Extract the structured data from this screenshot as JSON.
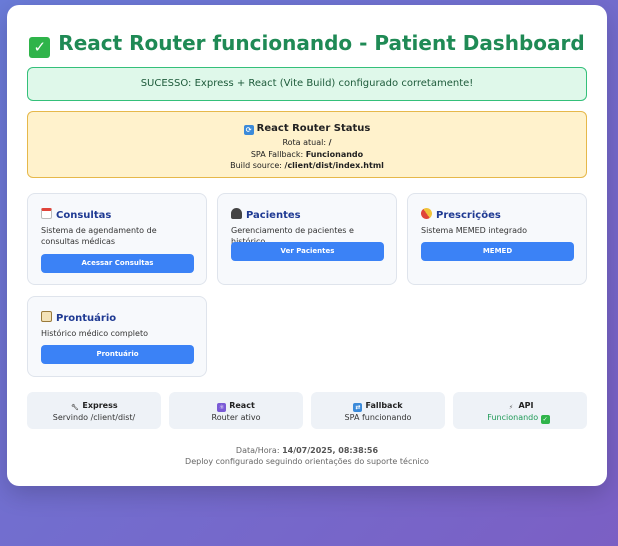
{
  "header": {
    "title": "React Router funcionando - Patient Dashboard",
    "title_icon": "check-mark-icon"
  },
  "success": {
    "text": "SUCESSO: Express + React (Vite Build) configurado corretamente!"
  },
  "router_status": {
    "title": "React Router Status",
    "icon": "sync-icon",
    "route_label": "Rota atual:",
    "route_value": "/",
    "fallback_label": "SPA Fallback:",
    "fallback_value": "Funcionando",
    "build_label": "Build source:",
    "build_value": "/client/dist/index.html"
  },
  "modules": [
    {
      "title": "Consultas",
      "icon": "calendar-icon",
      "description": "Sistema de agendamento de consultas médicas",
      "button": "Acessar Consultas"
    },
    {
      "title": "Pacientes",
      "icon": "people-icon",
      "description": "Gerenciamento de pacientes e histórico",
      "button": "Ver Pacientes"
    },
    {
      "title": "Prescrições",
      "icon": "pill-icon",
      "description": "Sistema MEMED integrado",
      "button": "MEMED"
    },
    {
      "title": "Prontuário",
      "icon": "clipboard-icon",
      "description": "Histórico médico completo",
      "button": "Prontuário"
    }
  ],
  "info_cards": [
    {
      "title": "Express",
      "icon": "wrench-icon",
      "subtitle": "Servindo /client/dist/"
    },
    {
      "title": "React",
      "icon": "react-icon",
      "subtitle": "Router ativo"
    },
    {
      "title": "Fallback",
      "icon": "shuffle-icon",
      "subtitle": "SPA funcionando"
    },
    {
      "title": "API",
      "icon": "plug-icon",
      "subtitle": "Funcionando",
      "status_icon": "check-mark-icon"
    }
  ],
  "footer": {
    "datetime_label": "Data/Hora:",
    "datetime_value": "14/07/2025, 08:38:56",
    "note": "Deploy configurado seguindo orientações do suporte técnico"
  },
  "colors": {
    "title": "#1f8a55",
    "success_bg": "#dff8ea",
    "status_bg": "#fff2cc",
    "button": "#3b82f6",
    "module_title": "#1f3a93"
  }
}
